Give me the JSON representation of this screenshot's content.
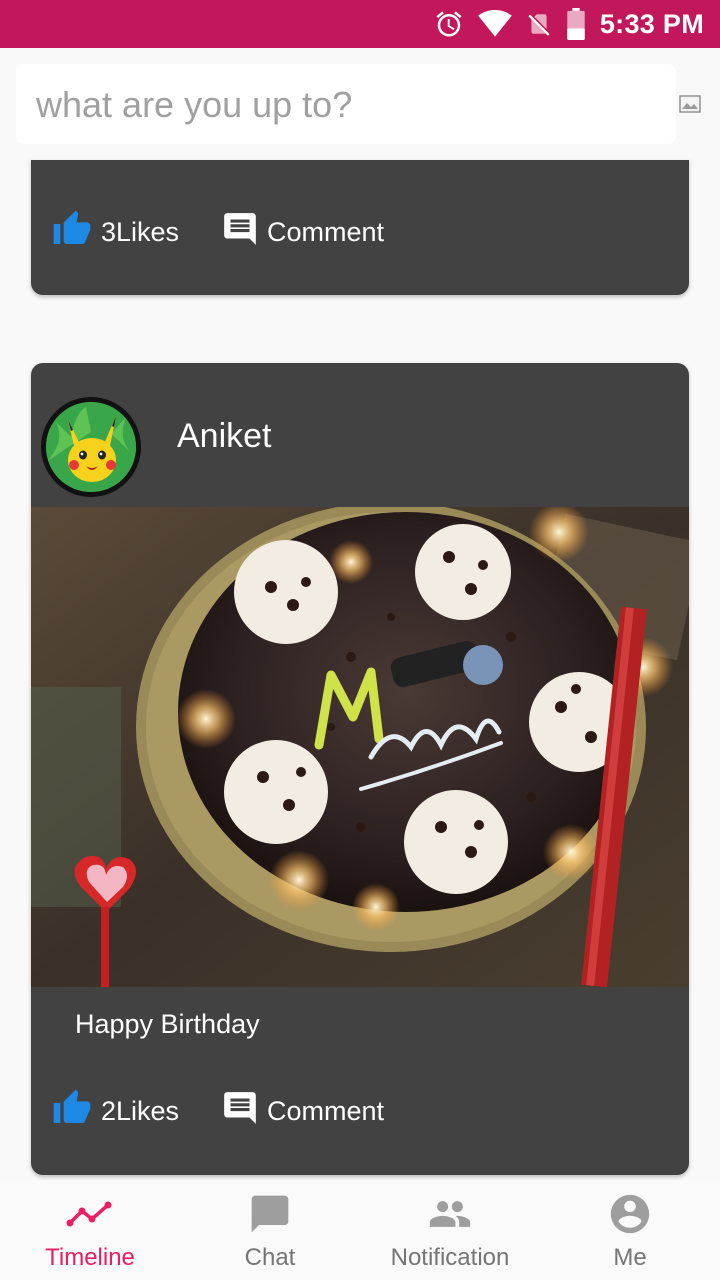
{
  "status_bar": {
    "time": "5:33 PM",
    "icons": [
      "alarm-icon",
      "wifi-icon",
      "no-sim-icon",
      "battery-icon"
    ],
    "background": "#c2185b"
  },
  "composer": {
    "placeholder": "what are you up to?",
    "attach_icon": "image-icon"
  },
  "posts": [
    {
      "likes_label": "3Likes",
      "comment_label": "Comment"
    },
    {
      "author": "Aniket",
      "caption": "Happy Birthday",
      "likes_label": "2Likes",
      "comment_label": "Comment"
    }
  ],
  "bottom_nav": {
    "items": [
      {
        "label": "Timeline",
        "icon": "timeline-icon",
        "active": true
      },
      {
        "label": "Chat",
        "icon": "chat-icon",
        "active": false
      },
      {
        "label": "Notification",
        "icon": "people-icon",
        "active": false
      },
      {
        "label": "Me",
        "icon": "account-circle-icon",
        "active": false
      }
    ]
  },
  "colors": {
    "accent": "#e91e63",
    "card": "#424242",
    "like_blue": "#1e88e5",
    "inactive": "#757575"
  }
}
